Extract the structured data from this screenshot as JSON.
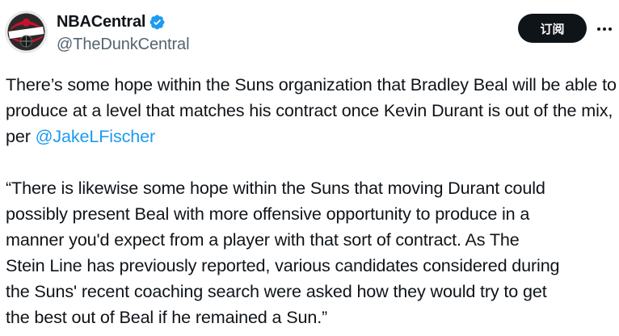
{
  "author": {
    "display_name": "NBACentral",
    "handle": "@TheDunkCentral",
    "avatar_icon": "nbacentral-logo-icon",
    "verified_icon": "verified-badge-icon"
  },
  "actions": {
    "subscribe_label": "订阅",
    "more_icon": "more-options-icon"
  },
  "tweet": {
    "paragraph1_text": "There’s some hope within the Suns organization that Bradley Beal will be able to produce at a level that matches his contract once Kevin Durant is out of the mix, per ",
    "paragraph1_mention": "@JakeLFischer",
    "paragraph2_lines": [
      "“There is likewise some hope within the Suns that moving Durant could",
      "possibly present Beal with more offensive opportunity to produce in a",
      "manner you'd expect from a player with that sort of contract.  As The",
      "Stein Line has previously reported, various candidates considered during",
      "the Suns' recent coaching search were asked how they would try to get",
      "the best out of Beal if he remained a Sun.”"
    ]
  },
  "colors": {
    "accent": "#1d9bf0",
    "text": "#0f1419",
    "secondary": "#536471",
    "button_bg": "#0f1419"
  }
}
